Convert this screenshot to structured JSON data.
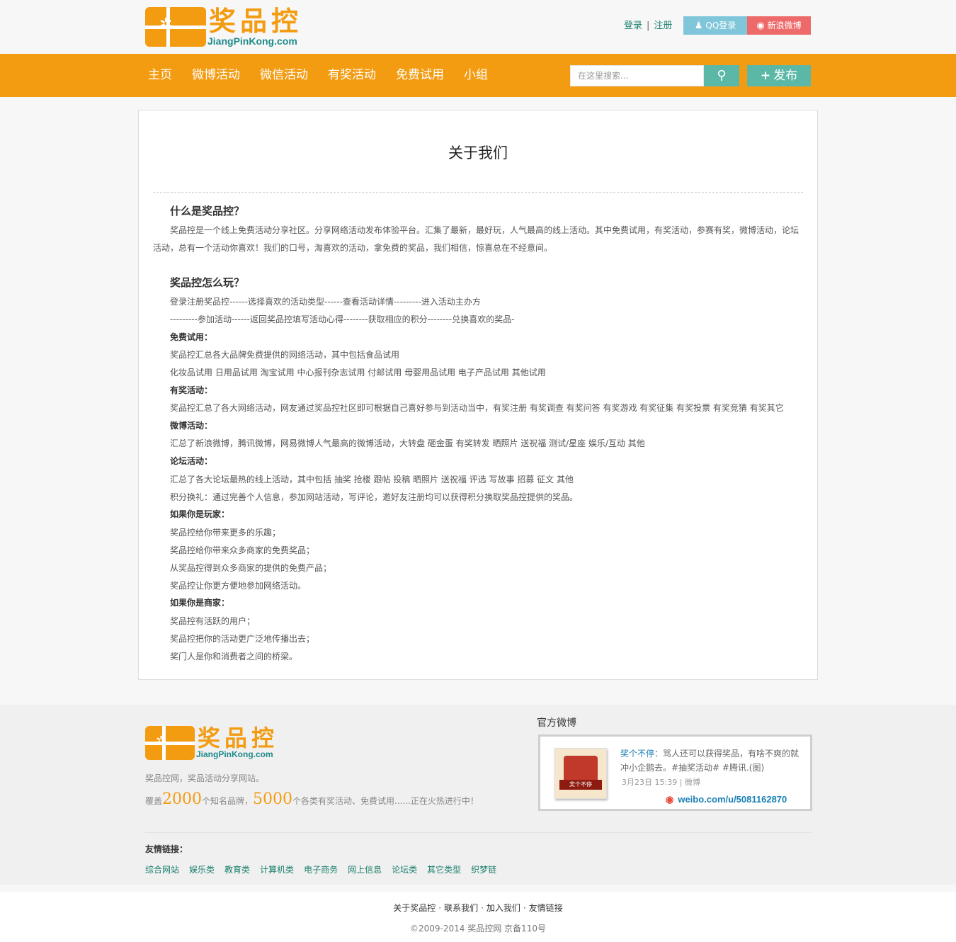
{
  "header": {
    "logo_cn": "奖品控",
    "logo_en": "JiangPinKong.com",
    "login": "登录",
    "register": "注册",
    "qq_login": "QQ登录",
    "weibo_login": "新浪微博"
  },
  "nav": {
    "items": [
      {
        "label": "主页"
      },
      {
        "label": "微博活动"
      },
      {
        "label": "微信活动"
      },
      {
        "label": "有奖活动"
      },
      {
        "label": "免费试用"
      },
      {
        "label": "小组"
      }
    ],
    "search_placeholder": "在这里搜索...",
    "publish": "发布"
  },
  "content": {
    "title": "关于我们",
    "section1_heading": "什么是奖品控？",
    "section1_text": "奖品控是一个线上免费活动分享社区。分享网络活动发布体验平台。汇集了最新，最好玩，人气最高的线上活动。其中免费试用，有奖活动，参赛有奖，微博活动，论坛活动，总有一个活动你喜欢！我们的口号，淘喜欢的活动，拿免费的奖品，我们相信，惊喜总在不经意间。",
    "section2_heading": "奖品控怎么玩？",
    "lines": [
      {
        "text": "登录注册奖品控------选择喜欢的活动类型------查看活动详情---------进入活动主办方",
        "bold": false
      },
      {
        "text": "---------参加活动------返回奖品控填写活动心得--------获取相应的积分--------兑换喜欢的奖品-",
        "bold": false
      },
      {
        "text": "免费试用：",
        "bold": true
      },
      {
        "text": "奖品控汇总各大品牌免费提供的网络活动，其中包括食品试用",
        "bold": false
      },
      {
        "text": "化妆品试用 日用品试用 淘宝试用 中心报刊杂志试用 付邮试用 母婴用品试用 电子产品试用 其他试用",
        "bold": false
      },
      {
        "text": "有奖活动：",
        "bold": true
      },
      {
        "text": "奖品控汇总了各大网络活动，网友通过奖品控社区即可根据自己喜好参与到活动当中，有奖注册 有奖调查 有奖问答 有奖游戏 有奖征集 有奖投票 有奖竞猜 有奖其它",
        "bold": false
      },
      {
        "text": "微博活动：",
        "bold": true
      },
      {
        "text": "汇总了新浪微博，腾讯微博，网易微博人气最高的微博活动，大转盘 砸金蛋 有奖转发 晒照片 送祝福 测试/星座 娱乐/互动 其他",
        "bold": false
      },
      {
        "text": "论坛活动：",
        "bold": true
      },
      {
        "text": "汇总了各大论坛最热的线上活动，其中包括 抽奖 抢楼 跟帖 投稿 晒照片 送祝福  评选 写故事  招募  征文  其他",
        "bold": false
      },
      {
        "text": "积分换礼：通过完善个人信息，参加网站活动，写评论，邀好友注册均可以获得积分换取奖品控提供的奖品。",
        "bold": false
      },
      {
        "text": "如果你是玩家：",
        "bold": true
      },
      {
        "text": "奖品控给你带来更多的乐趣；",
        "bold": false
      },
      {
        "text": "奖品控给你带来众多商家的免费奖品；",
        "bold": false
      },
      {
        "text": "从奖品控得到众多商家的提供的免费产品；",
        "bold": false
      },
      {
        "text": "奖品控让你更方便地参加网络活动。",
        "bold": false
      },
      {
        "text": "如果你是商家：",
        "bold": true
      },
      {
        "text": "奖品控有活跃的用户；",
        "bold": false
      },
      {
        "text": "奖品控把你的活动更广泛地传播出去；",
        "bold": false
      },
      {
        "text": "奖门人是你和消费者之间的桥梁。",
        "bold": false
      }
    ]
  },
  "footer": {
    "logo_cn": "奖品控",
    "logo_en": "JiangPinKong.com",
    "tagline": "奖品控网，奖品活动分享网站。",
    "stats_prefix": "覆盖",
    "brands_count": "2000",
    "stats_mid": "个知名品牌，",
    "activities_count": "5000",
    "stats_suffix": "个各类有奖活动、免费试用......正在火热进行中！",
    "weibo_title": "官方微博",
    "weibo_author": "奖个不停",
    "weibo_text": "：骂人还可以获得奖品，有啥不爽的就冲小企鹅去。#抽奖活动# #腾讯.(图)",
    "weibo_meta": "3月23日 15:39 | 微博",
    "weibo_link": "weibo.com/u/5081162870",
    "weibo_avatar_text": "奖个不停",
    "links_title": "友情链接：",
    "links": [
      "综合网站",
      "娱乐类",
      "教育类",
      "计算机类",
      "电子商务",
      "网上信息",
      "论坛类",
      "其它类型",
      "织梦链"
    ]
  },
  "bottom": {
    "links": [
      "关于奖品控",
      "联系我们",
      "加入我们",
      "友情链接"
    ],
    "copyright": "©2009-2014 奖品控网 京备110号"
  }
}
